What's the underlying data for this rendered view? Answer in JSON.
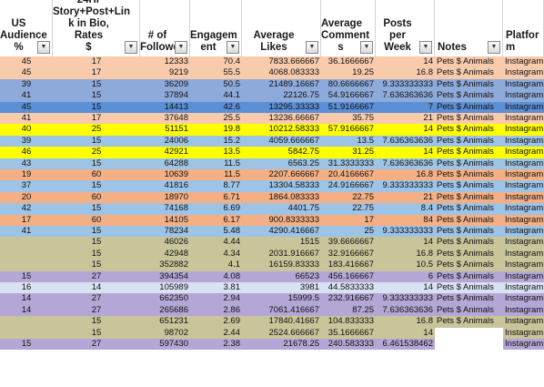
{
  "columns": [
    {
      "key": "us",
      "label": "US\nAudience\n%"
    },
    {
      "key": "rates",
      "label": "24Hr\nStory+Post+Lin\nk in Bio, Rates\n$"
    },
    {
      "key": "followers",
      "label": "# of\nFollowe"
    },
    {
      "key": "engagement",
      "label": "Engagem\nent"
    },
    {
      "key": "likes",
      "label": "Average\nLikes"
    },
    {
      "key": "comments",
      "label": "Average\nComment\ns"
    },
    {
      "key": "posts",
      "label": "Posts per\nWeek"
    },
    {
      "key": "notes",
      "label": "Notes"
    },
    {
      "key": "platform",
      "label": "Platfor\nm"
    }
  ],
  "colors": {
    "peach": "#f8cbad",
    "blue": "#8eaadb",
    "darkblue": "#5b8fd6",
    "yellow": "#ffff00",
    "lightblue": "#9dc3e6",
    "salmon": "#f4b084",
    "tan": "#c9c49a",
    "lavender": "#b4a7d6",
    "paleblue": "#d9e1f2",
    "white": "#ffffff"
  },
  "rows": [
    {
      "color": "peach",
      "us": "45",
      "rates": "17",
      "followers": "12333",
      "engagement": "70.4",
      "likes": "7833.666667",
      "comments": "36.1666667",
      "posts": "14",
      "notes": "Pets $ Animals",
      "platform": "Instagram"
    },
    {
      "color": "peach",
      "us": "45",
      "rates": "17",
      "followers": "9219",
      "engagement": "55.5",
      "likes": "4068.083333",
      "comments": "19.25",
      "posts": "16.8",
      "notes": "Pets $ Animals",
      "platform": "Instagram"
    },
    {
      "color": "blue",
      "us": "39",
      "rates": "15",
      "followers": "36209",
      "engagement": "50.5",
      "likes": "21489.16667",
      "comments": "80.6666667",
      "posts": "9.333333333",
      "notes": "Pets $ Animals",
      "platform": "Instagram"
    },
    {
      "color": "blue",
      "us": "41",
      "rates": "15",
      "followers": "37894",
      "engagement": "44.1",
      "likes": "22126.75",
      "comments": "54.9166667",
      "posts": "7.636363636",
      "notes": "Pets $ Animals",
      "platform": "Instagram"
    },
    {
      "color": "darkblue",
      "us": "45",
      "rates": "15",
      "followers": "14413",
      "engagement": "42.6",
      "likes": "13295.33333",
      "comments": "51.9166667",
      "posts": "7",
      "notes": "Pets $ Animals",
      "platform": "Instagram"
    },
    {
      "color": "peach",
      "us": "41",
      "rates": "17",
      "followers": "37648",
      "engagement": "25.5",
      "likes": "13236.66667",
      "comments": "35.75",
      "posts": "21",
      "notes": "Pets $ Animals",
      "platform": "Instagram"
    },
    {
      "color": "yellow",
      "us": "40",
      "rates": "25",
      "followers": "51151",
      "engagement": "19.8",
      "likes": "10212.58333",
      "comments": "57.9166667",
      "posts": "14",
      "notes": "Pets $ Animals",
      "platform": "Instagram"
    },
    {
      "color": "lightblue",
      "us": "39",
      "rates": "15",
      "followers": "24006",
      "engagement": "15.2",
      "likes": "4059.666667",
      "comments": "13.5",
      "posts": "7.636363636",
      "notes": "Pets $ Animals",
      "platform": "Instagram"
    },
    {
      "color": "yellow",
      "us": "46",
      "rates": "25",
      "followers": "42921",
      "engagement": "13.5",
      "likes": "5842.75",
      "comments": "31.25",
      "posts": "14",
      "notes": "Pets $ Animals",
      "platform": "Instagram"
    },
    {
      "color": "lightblue",
      "us": "43",
      "rates": "15",
      "followers": "64288",
      "engagement": "11.5",
      "likes": "6563.25",
      "comments": "31.3333333",
      "posts": "7.636363636",
      "notes": "Pets $ Animals",
      "platform": "Instagram"
    },
    {
      "color": "salmon",
      "us": "19",
      "rates": "60",
      "followers": "10639",
      "engagement": "11.5",
      "likes": "2207.666667",
      "comments": "20.4166667",
      "posts": "16.8",
      "notes": "Pets $ Animals",
      "platform": "Instagram"
    },
    {
      "color": "lightblue",
      "us": "37",
      "rates": "15",
      "followers": "41816",
      "engagement": "8.77",
      "likes": "13304.58333",
      "comments": "24.9166667",
      "posts": "9.333333333",
      "notes": "Pets $ Animals",
      "platform": "Instagram"
    },
    {
      "color": "salmon",
      "us": "20",
      "rates": "60",
      "followers": "18970",
      "engagement": "6.71",
      "likes": "1864.083333",
      "comments": "22.75",
      "posts": "21",
      "notes": "Pets $ Animals",
      "platform": "Instagram"
    },
    {
      "color": "lightblue",
      "us": "42",
      "rates": "15",
      "followers": "74168",
      "engagement": "6.69",
      "likes": "4401.75",
      "comments": "22.75",
      "posts": "8.4",
      "notes": "Pets $ Animals",
      "platform": "Instagram"
    },
    {
      "color": "salmon",
      "us": "17",
      "rates": "60",
      "followers": "14105",
      "engagement": "6.17",
      "likes": "900.8333333",
      "comments": "17",
      "posts": "84",
      "notes": "Pets $ Animals",
      "platform": "Instagram"
    },
    {
      "color": "lightblue",
      "us": "41",
      "rates": "15",
      "followers": "78234",
      "engagement": "5.48",
      "likes": "4290.416667",
      "comments": "25",
      "posts": "9.333333333",
      "notes": "Pets $ Animals",
      "platform": "Instagram"
    },
    {
      "color": "tan",
      "us": "",
      "rates": "15",
      "followers": "46026",
      "engagement": "4.44",
      "likes": "1515",
      "comments": "39.6666667",
      "posts": "14",
      "notes": "Pets $ Animals",
      "platform": "Instagram"
    },
    {
      "color": "tan",
      "us": "",
      "rates": "15",
      "followers": "42948",
      "engagement": "4.34",
      "likes": "2031.916667",
      "comments": "32.9166667",
      "posts": "16.8",
      "notes": "Pets $ Animals",
      "platform": "Instagram"
    },
    {
      "color": "tan",
      "us": "",
      "rates": "15",
      "followers": "352882",
      "engagement": "4.1",
      "likes": "16159.83333",
      "comments": "183.416667",
      "posts": "10.5",
      "notes": "Pets $ Animals",
      "platform": "Instagram"
    },
    {
      "color": "lavender",
      "us": "15",
      "rates": "27",
      "followers": "394354",
      "engagement": "4.08",
      "likes": "66523",
      "comments": "456.166667",
      "posts": "6",
      "notes": "Pets $ Animals",
      "platform": "Instagram"
    },
    {
      "color": "paleblue",
      "us": "16",
      "rates": "14",
      "followers": "105989",
      "engagement": "3.81",
      "likes": "3981",
      "comments": "44.5833333",
      "posts": "14",
      "notes": "Pets $ Animals",
      "platform": "Instagram"
    },
    {
      "color": "lavender",
      "us": "14",
      "rates": "27",
      "followers": "662350",
      "engagement": "2.94",
      "likes": "15999.5",
      "comments": "232.916667",
      "posts": "9.333333333",
      "notes": "Pets $ Animals",
      "platform": "Instagram"
    },
    {
      "color": "lavender",
      "us": "14",
      "rates": "27",
      "followers": "265686",
      "engagement": "2.86",
      "likes": "7061.416667",
      "comments": "87.25",
      "posts": "7.636363636",
      "notes": "Pets $ Animals",
      "platform": "Instagram"
    },
    {
      "color": "tan",
      "us": "",
      "rates": "15",
      "followers": "651231",
      "engagement": "2.69",
      "likes": "17840.41667",
      "comments": "104.833333",
      "posts": "16.8",
      "notes": "Pets $ Animals",
      "platform": "Instagram"
    },
    {
      "color": "tan",
      "us": "",
      "rates": "15",
      "followers": "98702",
      "engagement": "2.44",
      "likes": "2524.666667",
      "comments": "35.1666667",
      "posts": "14",
      "notes": "",
      "platform": "Instagram"
    },
    {
      "color": "lavender",
      "us": "15",
      "rates": "27",
      "followers": "597430",
      "engagement": "2.38",
      "likes": "21678.25",
      "comments": "240.583333",
      "posts": "6.461538462",
      "notes": "",
      "platform": "Instagram"
    }
  ]
}
